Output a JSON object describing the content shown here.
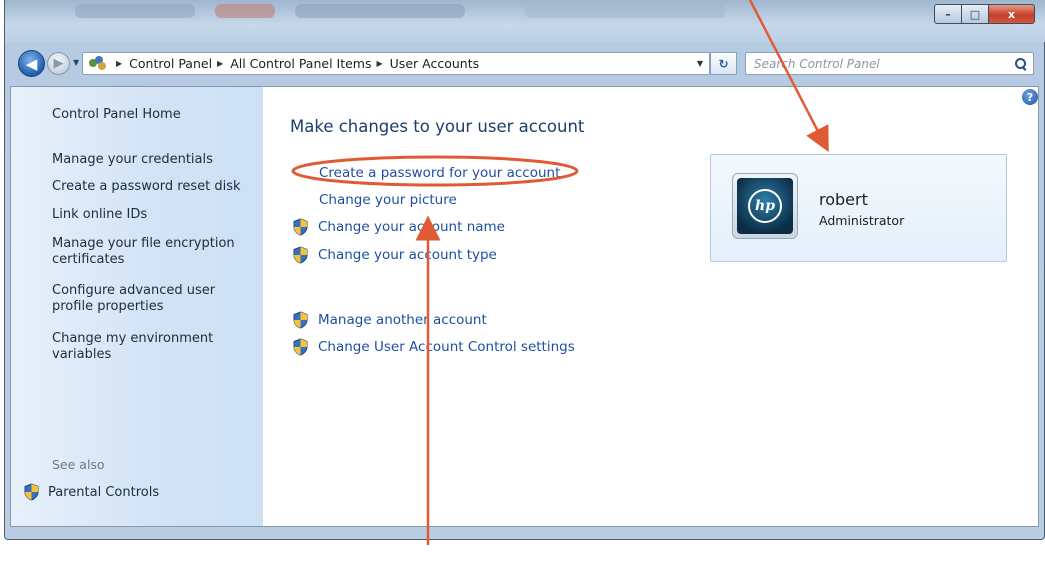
{
  "window": {
    "caption_buttons": {
      "minimize": "–",
      "maximize": "□",
      "close": "x"
    }
  },
  "navigation": {
    "back_glyph": "◀",
    "forward_glyph": "▶",
    "recent_glyph": "▼",
    "breadcrumbs": [
      "Control Panel",
      "All Control Panel Items",
      "User Accounts"
    ],
    "crumb_separator": "▶",
    "dropdown_glyph": "▼",
    "refresh_glyph": "↻"
  },
  "search": {
    "placeholder": "Search Control Panel",
    "icon": "search-icon"
  },
  "sidebar": {
    "home": "Control Panel Home",
    "links": [
      "Manage your credentials",
      "Create a password reset disk",
      "Link online IDs",
      "Manage your file encryption certificates",
      "Configure advanced user profile properties",
      "Change my environment variables"
    ],
    "see_also_label": "See also",
    "see_also_items": [
      "Parental Controls"
    ]
  },
  "main": {
    "heading": "Make changes to your user account",
    "tasks": [
      {
        "label": "Create a password for your account",
        "shield": false
      },
      {
        "label": "Change your picture",
        "shield": false
      },
      {
        "label": "Change your account name",
        "shield": true
      },
      {
        "label": "Change your account type",
        "shield": true
      },
      {
        "label": "Manage another account",
        "shield": true
      },
      {
        "label": "Change User Account Control settings",
        "shield": true
      }
    ]
  },
  "account": {
    "name": "robert",
    "role": "Administrator",
    "avatar_logo": "hp"
  },
  "help_glyph": "?",
  "colors": {
    "link": "#1e4fa4",
    "heading": "#1d3e6b",
    "annotation": "#e05a36",
    "sidebar": "#d2e3f5"
  }
}
